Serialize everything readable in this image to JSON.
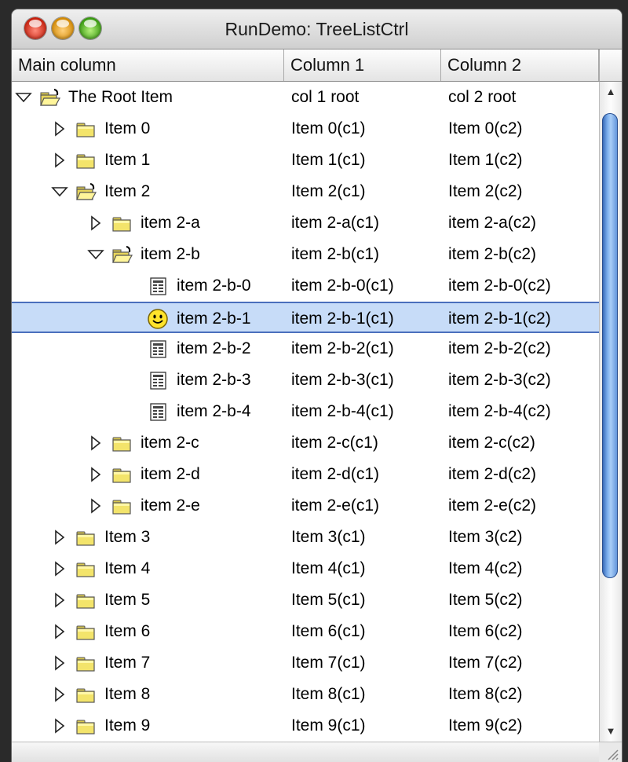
{
  "window": {
    "title": "RunDemo: TreeListCtrl"
  },
  "columns": [
    "Main column",
    "Column 1",
    "Column 2"
  ],
  "rows": [
    {
      "label": "The Root Item",
      "c1": "col 1 root",
      "c2": "col 2 root",
      "icon": "open-folder-icon",
      "expander": "expanded"
    },
    {
      "label": "Item 0",
      "c1": "Item 0(c1)",
      "c2": "Item 0(c2)",
      "icon": "folder-icon",
      "expander": "collapsed"
    },
    {
      "label": "Item 1",
      "c1": "Item 1(c1)",
      "c2": "Item 1(c2)",
      "icon": "folder-icon",
      "expander": "collapsed"
    },
    {
      "label": "Item 2",
      "c1": "Item 2(c1)",
      "c2": "Item 2(c2)",
      "icon": "open-folder-icon",
      "expander": "expanded"
    },
    {
      "label": "item 2-a",
      "c1": "item 2-a(c1)",
      "c2": "item 2-a(c2)",
      "icon": "folder-icon",
      "expander": "collapsed"
    },
    {
      "label": "item 2-b",
      "c1": "item 2-b(c1)",
      "c2": "item 2-b(c2)",
      "icon": "open-folder-icon",
      "expander": "expanded"
    },
    {
      "label": "item 2-b-0",
      "c1": "item 2-b-0(c1)",
      "c2": "item 2-b-0(c2)",
      "icon": "file-icon",
      "expander": "none"
    },
    {
      "label": "item 2-b-1",
      "c1": "item 2-b-1(c1)",
      "c2": "item 2-b-1(c2)",
      "icon": "smiley-icon",
      "expander": "none",
      "selected": true
    },
    {
      "label": "item 2-b-2",
      "c1": "item 2-b-2(c1)",
      "c2": "item 2-b-2(c2)",
      "icon": "file-icon",
      "expander": "none"
    },
    {
      "label": "item 2-b-3",
      "c1": "item 2-b-3(c1)",
      "c2": "item 2-b-3(c2)",
      "icon": "file-icon",
      "expander": "none"
    },
    {
      "label": "item 2-b-4",
      "c1": "item 2-b-4(c1)",
      "c2": "item 2-b-4(c2)",
      "icon": "file-icon",
      "expander": "none"
    },
    {
      "label": "item 2-c",
      "c1": "item 2-c(c1)",
      "c2": "item 2-c(c2)",
      "icon": "folder-icon",
      "expander": "collapsed"
    },
    {
      "label": "item 2-d",
      "c1": "item 2-d(c1)",
      "c2": "item 2-d(c2)",
      "icon": "folder-icon",
      "expander": "collapsed"
    },
    {
      "label": "item 2-e",
      "c1": "item 2-e(c1)",
      "c2": "item 2-e(c2)",
      "icon": "folder-icon",
      "expander": "collapsed"
    },
    {
      "label": "Item 3",
      "c1": "Item 3(c1)",
      "c2": "Item 3(c2)",
      "icon": "folder-icon",
      "expander": "collapsed"
    },
    {
      "label": "Item 4",
      "c1": "Item 4(c1)",
      "c2": "Item 4(c2)",
      "icon": "folder-icon",
      "expander": "collapsed"
    },
    {
      "label": "Item 5",
      "c1": "Item 5(c1)",
      "c2": "Item 5(c2)",
      "icon": "folder-icon",
      "expander": "collapsed"
    },
    {
      "label": "Item 6",
      "c1": "Item 6(c1)",
      "c2": "Item 6(c2)",
      "icon": "folder-icon",
      "expander": "collapsed"
    },
    {
      "label": "Item 7",
      "c1": "Item 7(c1)",
      "c2": "Item 7(c2)",
      "icon": "folder-icon",
      "expander": "collapsed"
    },
    {
      "label": "Item 8",
      "c1": "Item 8(c1)",
      "c2": "Item 8(c2)",
      "icon": "folder-icon",
      "expander": "collapsed"
    },
    {
      "label": "Item 9",
      "c1": "Item 9(c1)",
      "c2": "Item 9(c2)",
      "icon": "folder-icon",
      "expander": "collapsed"
    }
  ]
}
